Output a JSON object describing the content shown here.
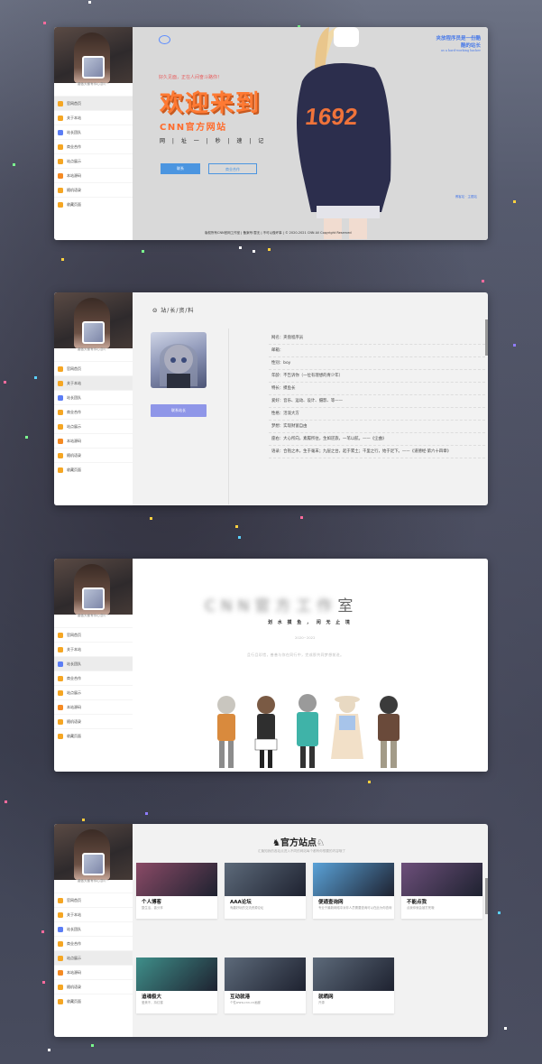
{
  "profile": {
    "motto": "要做天都有你心意吖~"
  },
  "menu": [
    "官网首页",
    "关于本站",
    "站长团队",
    "商业合作",
    "站点展示",
    "本站源码",
    "随机语录",
    "收藏页面"
  ],
  "hero": {
    "hello": "好久见面，正在人间奋斗路你！",
    "welcome": "欢迎来到",
    "site": "CNN官方网站",
    "url": "网 | 址  一 | 秒 | 速 | 记",
    "btn1": "联系",
    "btn2": "商业合作",
    "top_right_1": "夹放程序员是一份酷",
    "top_right_2": "酷的站长",
    "top_right_3": "as a hard-working hacker",
    "links": "博客站  ·  主题站",
    "footer": "版权所有CNN官网工作室    |    备案号:暂无 | 不可以做坏事    |    © 2020-2021 CNN All Copyright Reserved"
  },
  "about": {
    "title": "站/长/资/料",
    "contact": "联系站长",
    "lines": [
      "网名：夹盘程序员",
      "邮箱：",
      "性别：boy",
      "年龄：不告诉你（一位有理想的青少年）",
      "特长：摸鱼长",
      "爱好：音乐、运动、设计、摄影、等——",
      "性格：活泼大方",
      "梦想：实现财富自由",
      "座右：大心所向，素履所往，生如逆旅，一苇以航。——《尘曲》",
      "语录：合抱之木，生于毫末；九层之台，起于累土；千里之行，始于足下。——《道德经·第六十四章》"
    ]
  },
  "studio": {
    "name_blur": "CNN官方工作",
    "name_last": "室",
    "slogan": "划 水 摸 鱼 ， 闲 无 止 境",
    "years": "2020~2022",
    "desc": "且行且珍惜，善善与你在同行中，完成那共同梦想前进。"
  },
  "sites": {
    "title": "官方站点",
    "subtitle": "汇聚知我的各站点进入不同的网站每个都有你想要的内容哦了",
    "tiles": [
      {
        "name": "个人博客",
        "desc": "整生活，善分享",
        "color": "#8a4a66"
      },
      {
        "name": "AAA论坛",
        "desc": "有趣好玩的交流资源论坛",
        "color": "#5d6a7a"
      },
      {
        "name": "便通查询网",
        "desc": "专业于最新网络中对非人员需要查询可以在此为你查询",
        "color": "#5aa2d8"
      },
      {
        "name": "不能点我",
        "desc": "点我你就会被打死哦",
        "color": "#6d4f7a"
      },
      {
        "name": "追魂极大",
        "desc": "爱美不，持红楼",
        "color": "#3f8f8a"
      },
      {
        "name": "互动就港",
        "desc": "个性www.cnn.cn画廊",
        "color": "#5d6a7a"
      },
      {
        "name": "就晒网",
        "desc": "开源",
        "color": "#5d6a7a"
      }
    ]
  }
}
